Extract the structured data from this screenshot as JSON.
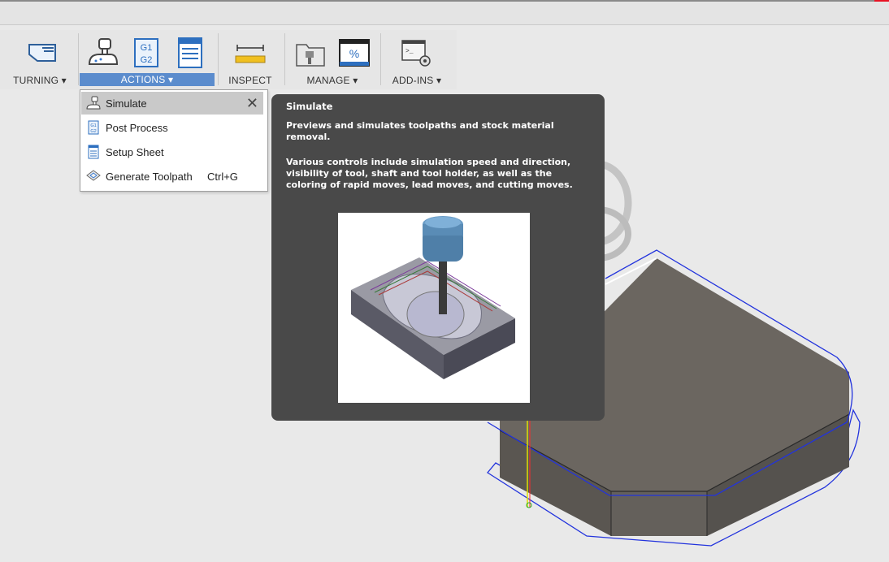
{
  "ribbon": {
    "groups": [
      {
        "label": "TURNING ▾",
        "icon": "turning-icon"
      },
      {
        "label": "ACTIONS ▾",
        "icons": [
          "simulate-icon",
          "post-process-icon",
          "setup-sheet-icon"
        ]
      },
      {
        "label": "INSPECT",
        "icon": "ruler-icon"
      },
      {
        "label": "MANAGE ▾",
        "icons": [
          "tool-library-icon",
          "post-library-icon"
        ]
      },
      {
        "label": "ADD-INS ▾",
        "icon": "scripts-icon"
      }
    ],
    "post_icon_text": [
      "G1",
      "G2"
    ],
    "percent_icon_text": "%"
  },
  "actions_menu": {
    "items": [
      {
        "label": "Simulate",
        "icon": "simulate-icon",
        "shortcut": "",
        "selected": true
      },
      {
        "label": "Post Process",
        "icon": "post-process-icon",
        "shortcut": ""
      },
      {
        "label": "Setup Sheet",
        "icon": "setup-sheet-icon",
        "shortcut": ""
      },
      {
        "label": "Generate Toolpath",
        "icon": "generate-toolpath-icon",
        "shortcut": "Ctrl+G"
      }
    ],
    "close_glyph": "✕"
  },
  "tooltip": {
    "title": "Simulate",
    "summary": "Previews and simulates toolpaths and stock material removal.",
    "details": "Various controls include simulation speed and direction, visibility of tool, shaft and tool holder, as well as the coloring of rapid moves, lead moves, and cutting moves."
  },
  "colors": {
    "accent": "#5b8ccd",
    "tooltip_bg": "#494949",
    "toolpath": "#2233dd",
    "stock": "#6b6660"
  }
}
